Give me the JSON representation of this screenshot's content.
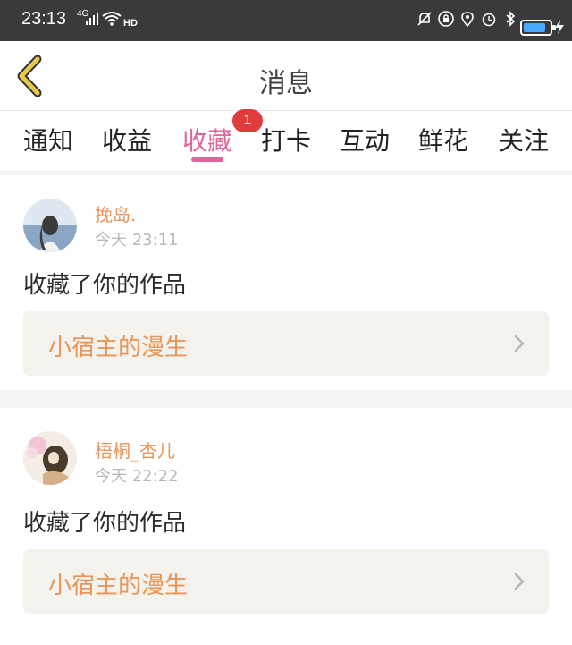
{
  "status_bar": {
    "time": "23:13",
    "network": "4G",
    "hd": "HD",
    "icons": [
      "mute-icon",
      "lock-icon",
      "location-icon",
      "alarm-icon",
      "bluetooth-icon",
      "battery-icon",
      "charging-icon"
    ]
  },
  "header": {
    "title": "消息"
  },
  "tabs": [
    {
      "label": "通知"
    },
    {
      "label": "收益"
    },
    {
      "label": "收藏",
      "active": true,
      "badge": "1"
    },
    {
      "label": "打卡"
    },
    {
      "label": "互动"
    },
    {
      "label": "鲜花"
    },
    {
      "label": "关注"
    }
  ],
  "messages": [
    {
      "user": "挽岛.",
      "time": "今天 23:11",
      "action": "收藏了你的作品",
      "work_title": "小宿主的漫生"
    },
    {
      "user": "梧桐_杏儿",
      "time": "今天 22:22",
      "action": "收藏了你的作品",
      "work_title": "小宿主的漫生"
    }
  ],
  "colors": {
    "accent": "#e0669a",
    "badge": "#e23b3b",
    "username": "#e8955b",
    "work_bg": "#f4f2ec",
    "back_arrow": "#e6c84a"
  }
}
